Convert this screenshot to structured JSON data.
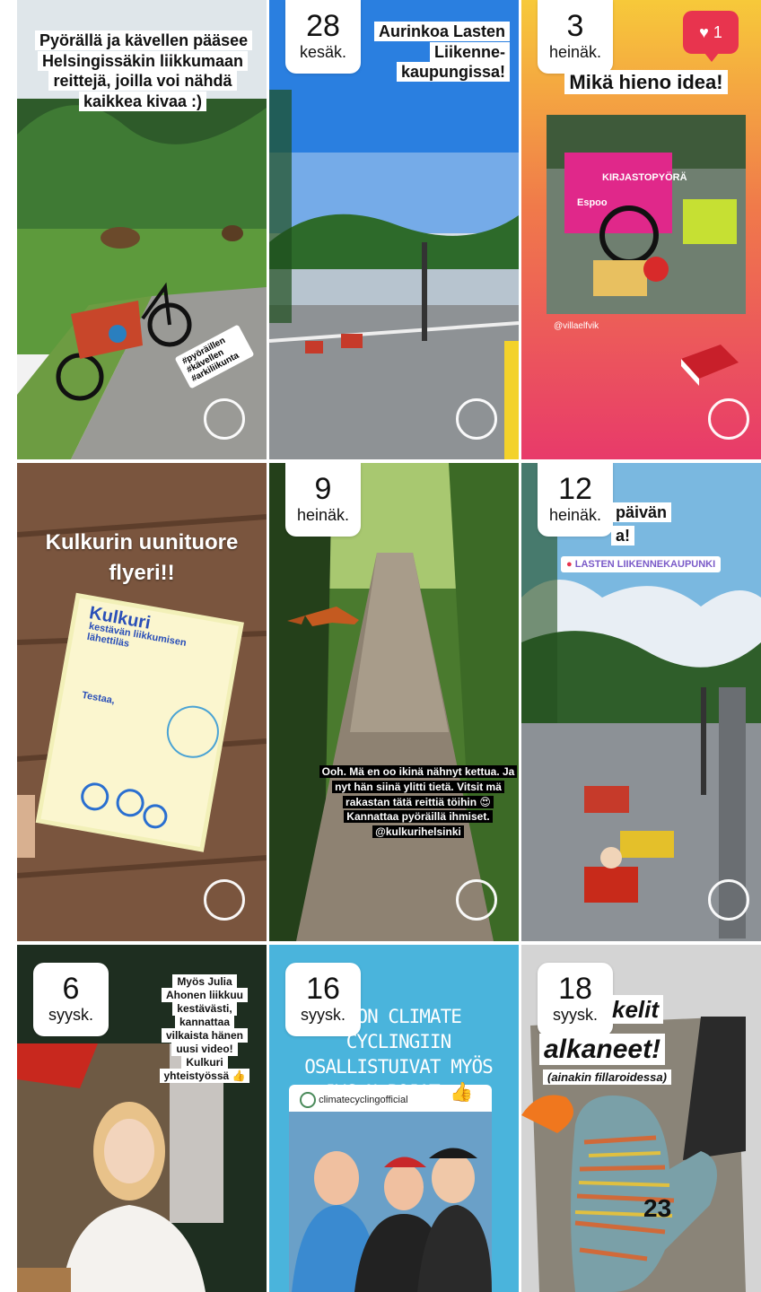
{
  "colors": {
    "story_ring": "#ffffff",
    "like_badge": "#e8344e"
  },
  "tiles": [
    {
      "caption": "Pyörällä ja kävellen pääsee Helsingissäkin liikkumaan reittejä, joilla voi nähdä kaikkea kivaa :)",
      "hashtags": "#pyöräillen #kävellen #arkiliikunta"
    },
    {
      "day": "28",
      "month": "kesäk.",
      "caption": "Aurinkoa Lasten Liikenne-kaupungissa!"
    },
    {
      "day": "3",
      "month": "heinäk.",
      "likes": "1",
      "caption": "Mikä hieno idea!",
      "cart_text": "KIRJASTOPYÖRÄ",
      "cart_text2": "Espoo",
      "credit": "@villaelfvik"
    },
    {
      "caption": "Kulkurin uunituore flyeri!!",
      "flyer_title": "Kulkuri",
      "flyer_subtitle": "kestävän liikkumisen lähettiläs",
      "flyer_heading": "Testaa,"
    },
    {
      "day": "9",
      "month": "heinäk.",
      "caption": "Ooh. Mä en oo ikinä nähnyt kettua. Ja nyt hän siinä ylitti tietä. Vitsit mä rakastan tätä reittiä töihin 😍 Kannattaa pyöräillä ihmiset. @kulkurihelsinki"
    },
    {
      "day": "12",
      "month": "heinäk.",
      "caption": "päivän",
      "caption2": "a!",
      "location": "LASTEN LIIKENNEKAUPUNKI"
    },
    {
      "day": "6",
      "month": "syysk.",
      "caption": "Myös Julia Ahonen liikkuu kestävästi, kannattaa vilkaista hänen uusi video! Kulkuri yhteistyössä 👍"
    },
    {
      "day": "16",
      "month": "syysk.",
      "caption": "IKON CLIMATE CYCLINGIIN OSALLISTUIVAT MYÖS JVC:N POJAT 👍",
      "account": "climatecyclingofficial"
    },
    {
      "day": "18",
      "month": "syysk.",
      "caption": "kelit",
      "caption2": "alkaneet!",
      "caption3": "(ainakin fillaroidessa)",
      "page_number": "23"
    }
  ]
}
